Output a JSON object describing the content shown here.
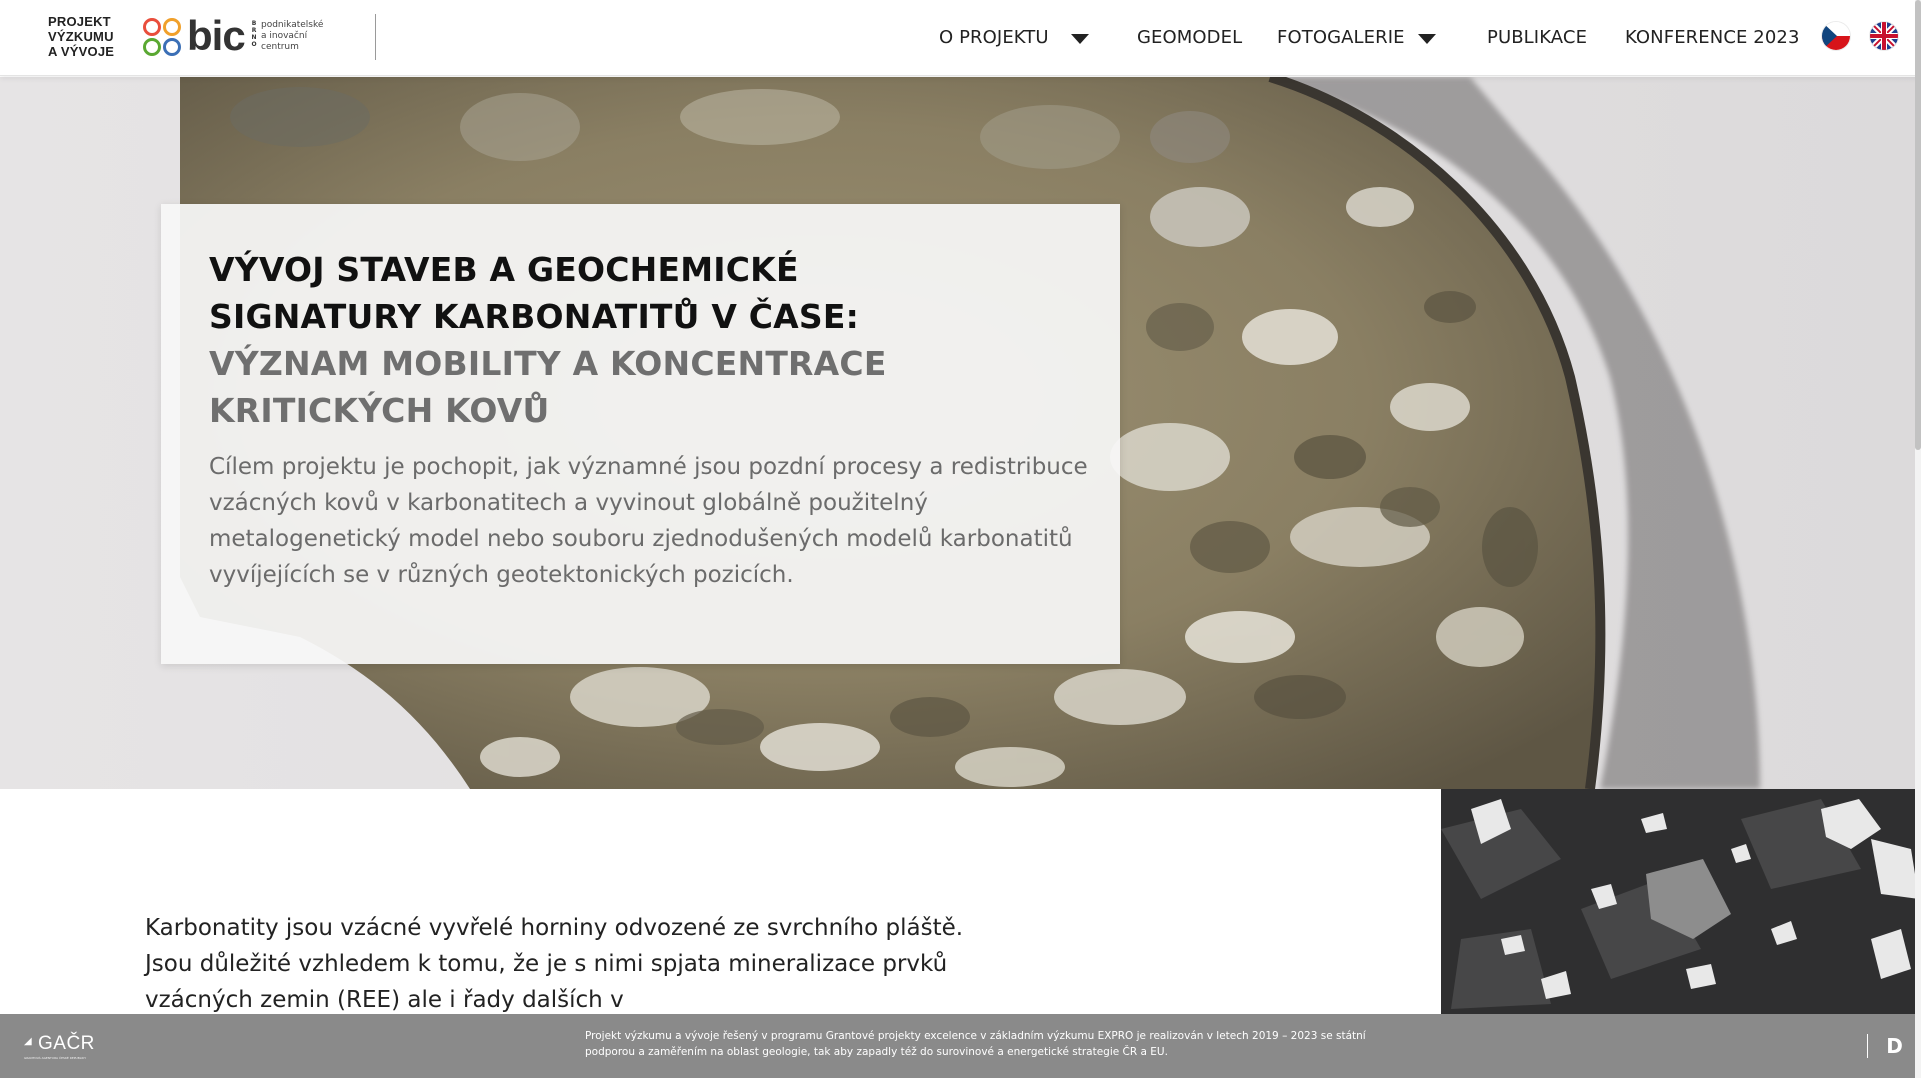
{
  "header": {
    "project_logo_lines": [
      "PROJEKT",
      "VÝZKUMU",
      "A VÝVOJE"
    ],
    "bic_logo": {
      "word": "bic",
      "city": "BRNO",
      "subtitle_lines": [
        "podnikatelské",
        "a inovační",
        "centrum"
      ],
      "circle_colors": [
        "#e94e3c",
        "#f0a02b",
        "#5aa832",
        "#3b6fb6"
      ]
    },
    "nav": [
      {
        "label": "O PROJEKTU",
        "has_dropdown": true
      },
      {
        "label": "GEOMODEL",
        "has_dropdown": false
      },
      {
        "label": "FOTOGALERIE",
        "has_dropdown": true
      },
      {
        "label": "PUBLIKACE",
        "has_dropdown": false
      },
      {
        "label": "KONFERENCE 2023",
        "has_dropdown": false
      }
    ],
    "languages": [
      {
        "code": "cs",
        "icon": "czech-flag-icon"
      },
      {
        "code": "en",
        "icon": "uk-flag-icon"
      }
    ]
  },
  "hero": {
    "title_lines": [
      "VÝVOJ STAVEB A GEOCHEMICKÉ",
      "SIGNATURY KARBONATITŮ V ČASE:"
    ],
    "subtitle_lines": [
      "VÝZNAM MOBILITY A KONCENTRACE",
      "KRITICKÝCH KOVŮ"
    ],
    "text": "Cílem projektu je pochopit, jak významné jsou pozdní procesy a redistribuce vzácných kovů v karbonatitech a vyvinout globálně použitelný metalogenetický model nebo souboru zjednodušených modelů karbonatitů vyvíjejících se v různých geotektonických pozicích."
  },
  "content": {
    "intro_text": "Karbonatity jsou vzácné vyvřelé horniny odvozené ze svrchního pláště. Jsou důležité vzhledem k tomu, že je s nimi spjata mineralizace prvků vzácných zemin (REE) ale i řady dalších v"
  },
  "footer": {
    "funder_logo": "GAČR",
    "funder_tagline": "GRANTOVÁ AGENTURA ČESKÉ REPUBLIKY",
    "text_lines": [
      "Projekt výzkumu a vývoje řešený v programu Grantové projekty excelence v základním výzkumu EXPRO je realizován v letech 2019 – 2023 se státní",
      "podporou a zaměřením na oblast geologie, tak aby zapadly též do surovinové a energetické strategie ČR a EU."
    ],
    "right_button_label": "D"
  },
  "colors": {
    "footer_bg": "#8a8a8a",
    "hero_card_bg": "#f8f8f8",
    "title_dark": "#111111",
    "title_grey": "#6f6f6f"
  }
}
